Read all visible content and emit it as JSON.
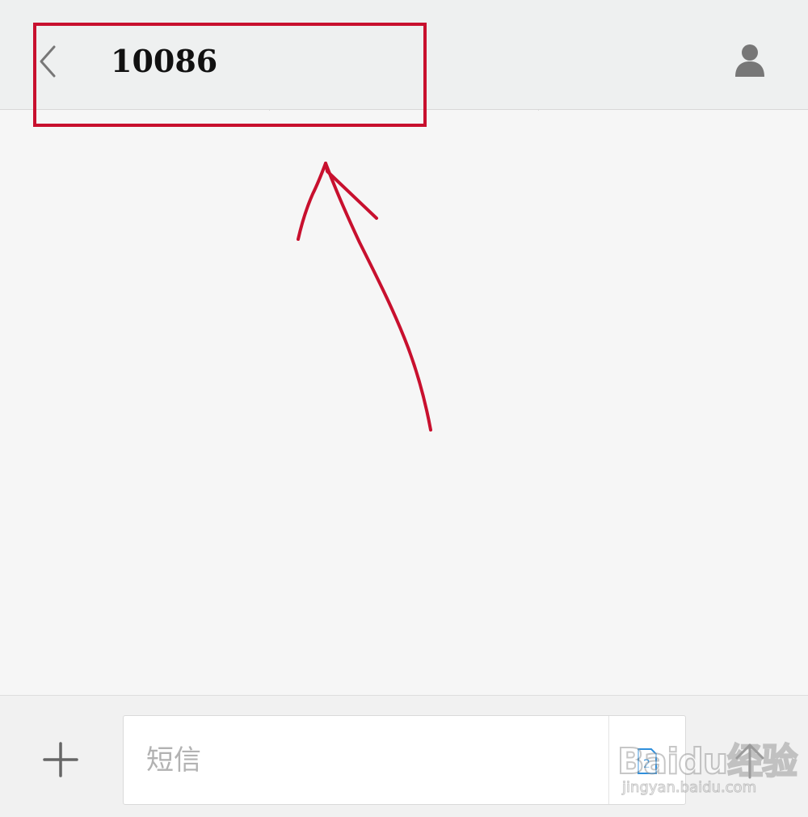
{
  "header": {
    "title": "10086",
    "back_icon": "chevron-left-icon",
    "contact_icon": "person-icon"
  },
  "annotation": {
    "highlight_color": "#c8102e",
    "arrow_color": "#c8102e"
  },
  "composer": {
    "placeholder": "短信",
    "add_icon": "plus-icon",
    "sim_icon": "sim-card-icon",
    "send_icon": "send-arrow-icon"
  },
  "watermark": {
    "main": "Baidu经验",
    "sub": "jingyan.baidu.com"
  },
  "colors": {
    "header_bg": "#eef0f0",
    "thread_bg": "#f6f6f6",
    "icon_gray": "#777777",
    "accent_blue": "#2f8fdc"
  }
}
